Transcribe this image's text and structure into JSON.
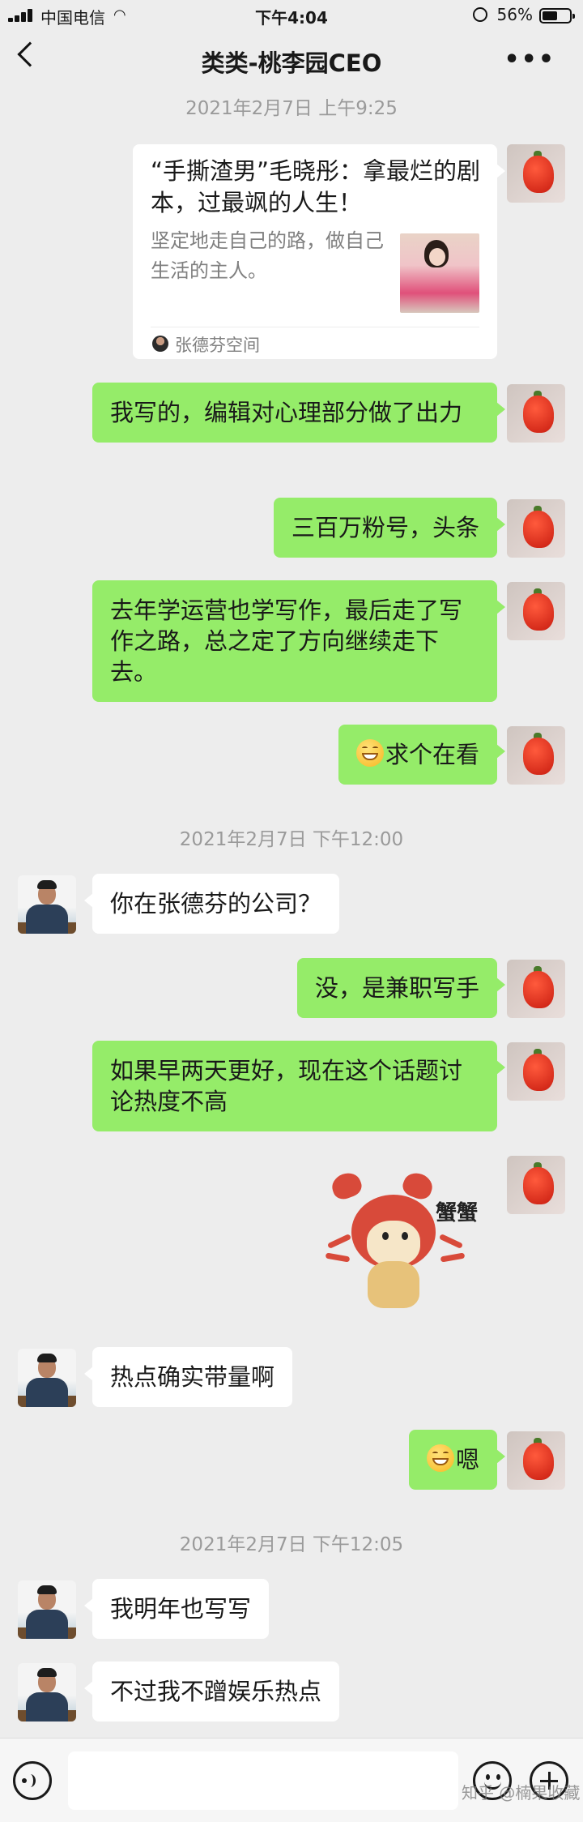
{
  "status_bar": {
    "carrier": "中国电信",
    "time": "下午4:04",
    "battery": "56%",
    "battery_level": 0.56
  },
  "nav": {
    "title": "类类-桃李园CEO"
  },
  "messages": {
    "ts1": "2021年2月7日 上午9:25",
    "card": {
      "title": "“手撕渣男”毛晓彤：拿最烂的剧本，过最飒的人生！",
      "desc": "坚定地走自己的路，做自己生活的主人。",
      "source": "张德芬空间"
    },
    "m1": "我写的，编辑对心理部分做了出力",
    "m2": "三百万粉号，头条",
    "m3": "去年学运营也学写作，最后走了写作之路，总之定了方向继续走下去。",
    "m4": "求个在看",
    "ts2": "2021年2月7日 下午12:00",
    "m5": "你在张德芬的公司？",
    "m6": "没，是兼职写手",
    "m7": "如果早两天更好，现在这个话题讨论热度不高",
    "sticker_text": "蟹蟹",
    "m8": "热点确实带量啊",
    "m9": "嗯",
    "ts3": "2021年2月7日 下午12:05",
    "m10": "我明年也写写",
    "m11": "不过我不蹭娱乐热点"
  },
  "watermark": "知乎 @楠果收藏"
}
